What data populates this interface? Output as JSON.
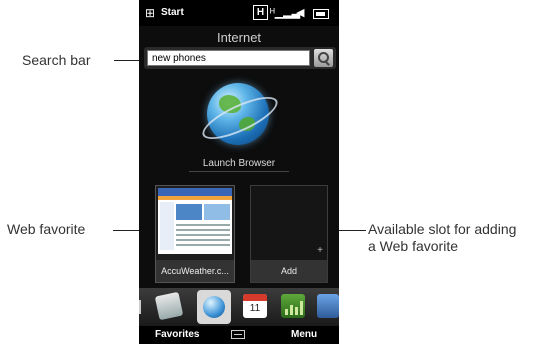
{
  "callouts": {
    "search_bar": "Search bar",
    "web_favorite": "Web favorite",
    "available_slot_line1": "Available slot for adding",
    "available_slot_line2": "a Web favorite"
  },
  "status_bar": {
    "start_label": "Start",
    "network_badge": "H"
  },
  "screen": {
    "title": "Internet",
    "search_value": "new phones",
    "launch_label": "Launch Browser"
  },
  "favorites": [
    {
      "label": "AccuWeather.c..."
    },
    {
      "label": "Add"
    }
  ],
  "tabs": {
    "calendar_day": "11"
  },
  "softkeys": {
    "left": "Favorites",
    "right": "Menu"
  },
  "icons": [
    "windows-logo-icon",
    "signal-icon",
    "speaker-icon",
    "battery-icon",
    "search-icon",
    "globe-icon",
    "mail-icon",
    "calendar-icon",
    "stocks-icon",
    "photos-icon",
    "keyboard-icon"
  ]
}
